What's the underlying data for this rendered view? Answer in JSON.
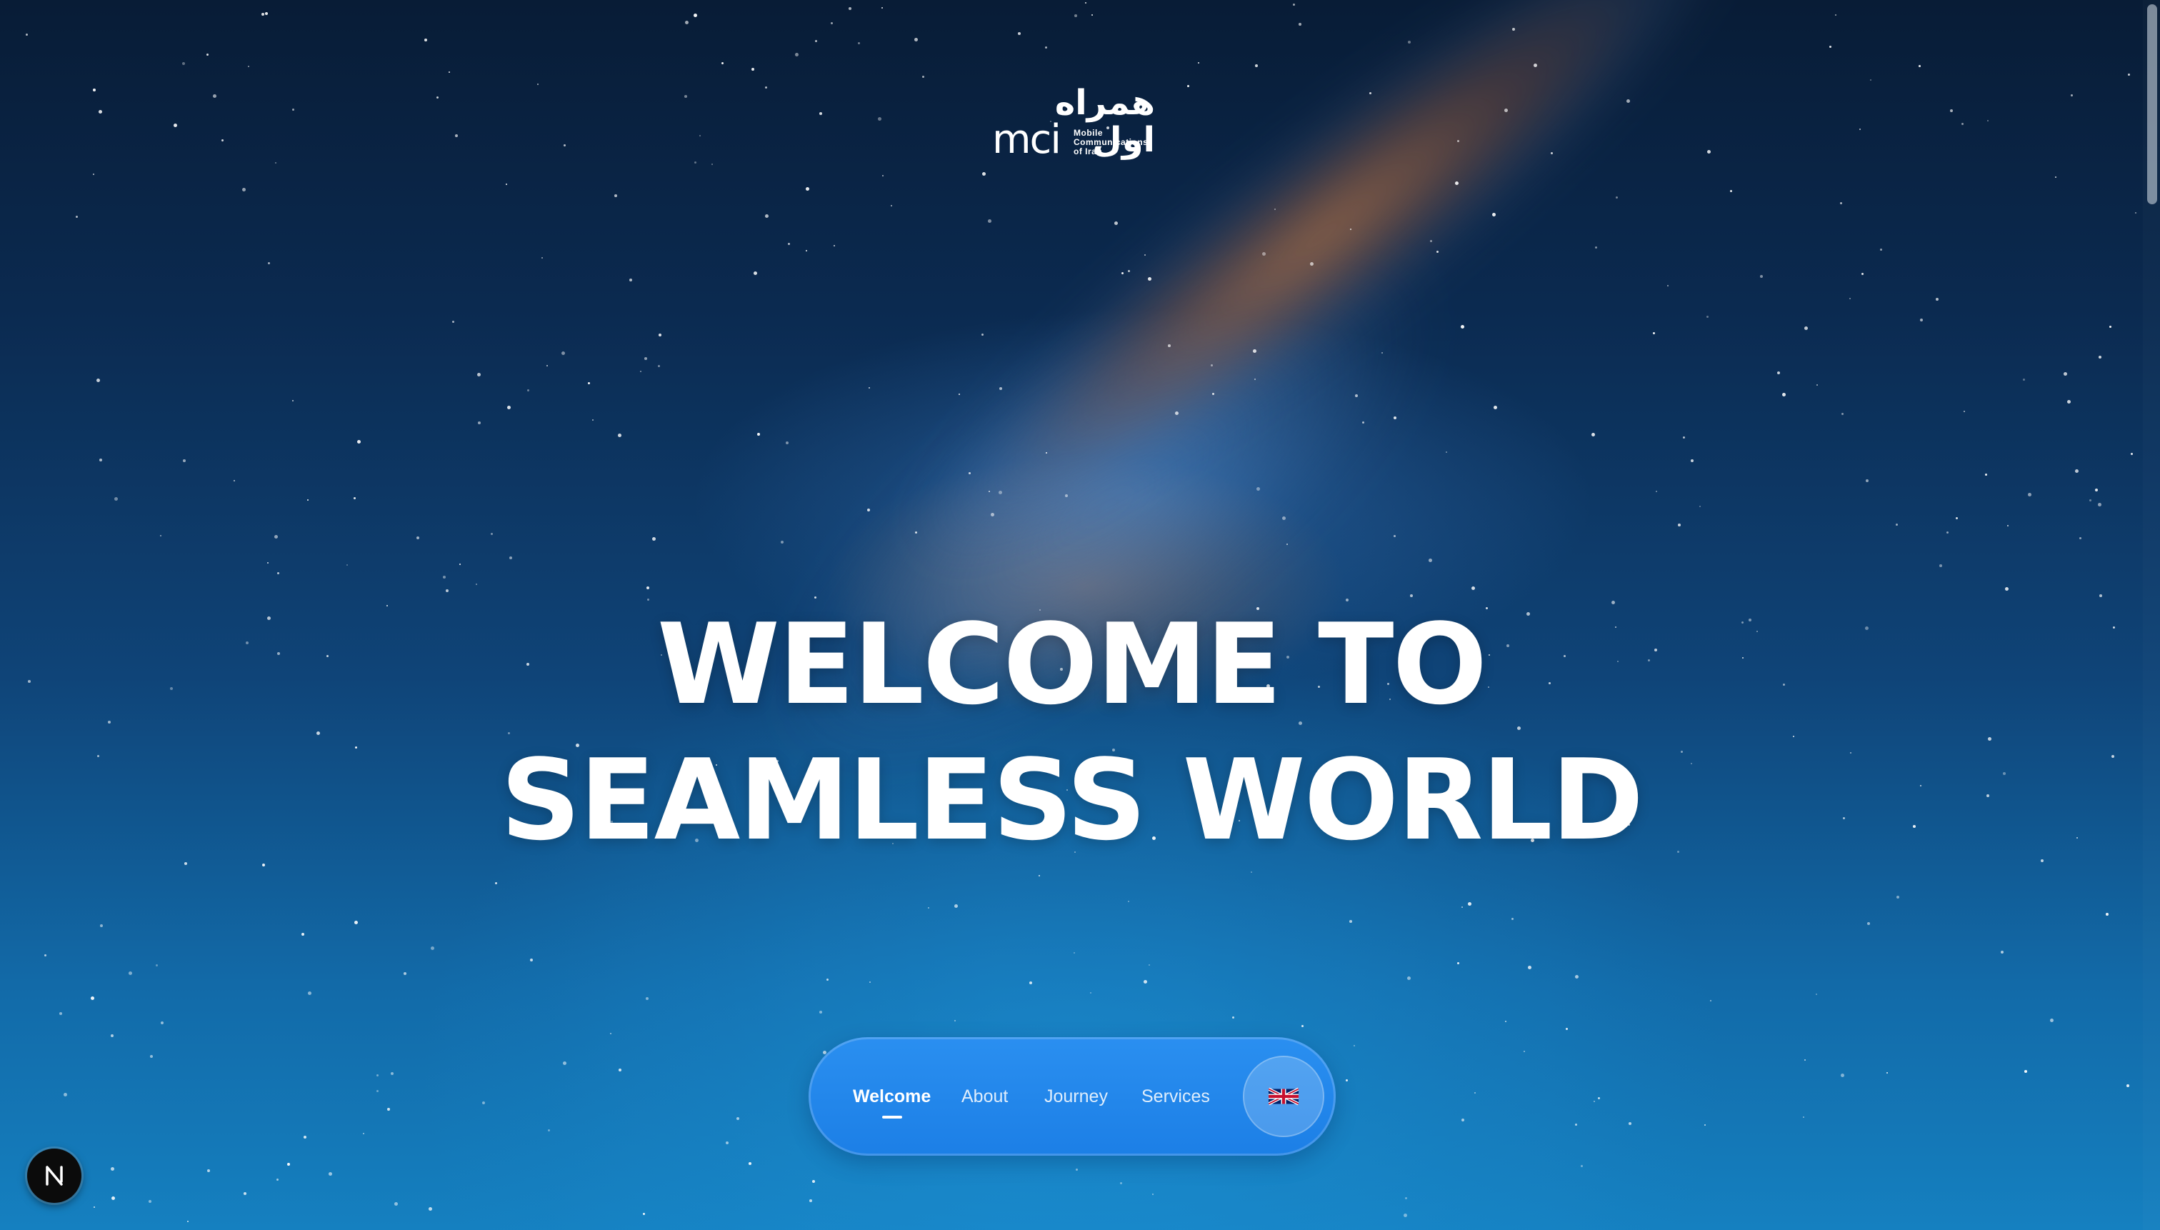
{
  "brand": {
    "logo_persian": "همراه اول",
    "logo_latin": "mci",
    "logo_sub_line1": "Mobile",
    "logo_sub_line2": "Communications",
    "logo_sub_line3": "of Iran"
  },
  "hero": {
    "line1": "WELCOME TO",
    "line2": "SEAMLESS WORLD"
  },
  "nav": {
    "items": [
      {
        "label": "Welcome",
        "active": true
      },
      {
        "label": "About",
        "active": false
      },
      {
        "label": "Journey",
        "active": false
      },
      {
        "label": "Services",
        "active": false
      }
    ],
    "language_icon": "uk-flag-icon"
  },
  "dev_badge": {
    "letter": "N"
  },
  "colors": {
    "nav_background": "#1c7fe6",
    "hero_text": "#ffffff",
    "sky_top": "#081c36",
    "sky_bottom": "#1580c0"
  }
}
